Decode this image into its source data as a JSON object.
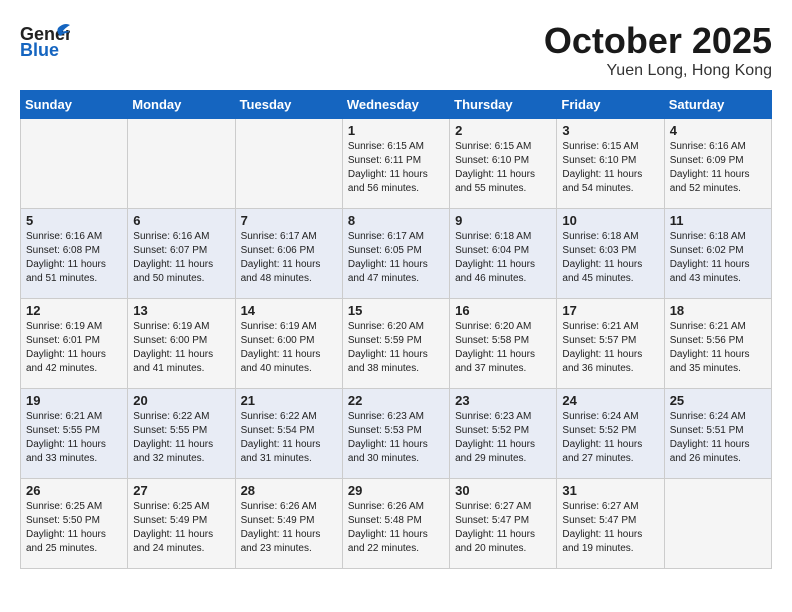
{
  "header": {
    "logo_general": "General",
    "logo_blue": "Blue",
    "month": "October 2025",
    "location": "Yuen Long, Hong Kong"
  },
  "days_of_week": [
    "Sunday",
    "Monday",
    "Tuesday",
    "Wednesday",
    "Thursday",
    "Friday",
    "Saturday"
  ],
  "weeks": [
    [
      {
        "day": "",
        "info": ""
      },
      {
        "day": "",
        "info": ""
      },
      {
        "day": "",
        "info": ""
      },
      {
        "day": "1",
        "info": "Sunrise: 6:15 AM\nSunset: 6:11 PM\nDaylight: 11 hours and 56 minutes."
      },
      {
        "day": "2",
        "info": "Sunrise: 6:15 AM\nSunset: 6:10 PM\nDaylight: 11 hours and 55 minutes."
      },
      {
        "day": "3",
        "info": "Sunrise: 6:15 AM\nSunset: 6:10 PM\nDaylight: 11 hours and 54 minutes."
      },
      {
        "day": "4",
        "info": "Sunrise: 6:16 AM\nSunset: 6:09 PM\nDaylight: 11 hours and 52 minutes."
      }
    ],
    [
      {
        "day": "5",
        "info": "Sunrise: 6:16 AM\nSunset: 6:08 PM\nDaylight: 11 hours and 51 minutes."
      },
      {
        "day": "6",
        "info": "Sunrise: 6:16 AM\nSunset: 6:07 PM\nDaylight: 11 hours and 50 minutes."
      },
      {
        "day": "7",
        "info": "Sunrise: 6:17 AM\nSunset: 6:06 PM\nDaylight: 11 hours and 48 minutes."
      },
      {
        "day": "8",
        "info": "Sunrise: 6:17 AM\nSunset: 6:05 PM\nDaylight: 11 hours and 47 minutes."
      },
      {
        "day": "9",
        "info": "Sunrise: 6:18 AM\nSunset: 6:04 PM\nDaylight: 11 hours and 46 minutes."
      },
      {
        "day": "10",
        "info": "Sunrise: 6:18 AM\nSunset: 6:03 PM\nDaylight: 11 hours and 45 minutes."
      },
      {
        "day": "11",
        "info": "Sunrise: 6:18 AM\nSunset: 6:02 PM\nDaylight: 11 hours and 43 minutes."
      }
    ],
    [
      {
        "day": "12",
        "info": "Sunrise: 6:19 AM\nSunset: 6:01 PM\nDaylight: 11 hours and 42 minutes."
      },
      {
        "day": "13",
        "info": "Sunrise: 6:19 AM\nSunset: 6:00 PM\nDaylight: 11 hours and 41 minutes."
      },
      {
        "day": "14",
        "info": "Sunrise: 6:19 AM\nSunset: 6:00 PM\nDaylight: 11 hours and 40 minutes."
      },
      {
        "day": "15",
        "info": "Sunrise: 6:20 AM\nSunset: 5:59 PM\nDaylight: 11 hours and 38 minutes."
      },
      {
        "day": "16",
        "info": "Sunrise: 6:20 AM\nSunset: 5:58 PM\nDaylight: 11 hours and 37 minutes."
      },
      {
        "day": "17",
        "info": "Sunrise: 6:21 AM\nSunset: 5:57 PM\nDaylight: 11 hours and 36 minutes."
      },
      {
        "day": "18",
        "info": "Sunrise: 6:21 AM\nSunset: 5:56 PM\nDaylight: 11 hours and 35 minutes."
      }
    ],
    [
      {
        "day": "19",
        "info": "Sunrise: 6:21 AM\nSunset: 5:55 PM\nDaylight: 11 hours and 33 minutes."
      },
      {
        "day": "20",
        "info": "Sunrise: 6:22 AM\nSunset: 5:55 PM\nDaylight: 11 hours and 32 minutes."
      },
      {
        "day": "21",
        "info": "Sunrise: 6:22 AM\nSunset: 5:54 PM\nDaylight: 11 hours and 31 minutes."
      },
      {
        "day": "22",
        "info": "Sunrise: 6:23 AM\nSunset: 5:53 PM\nDaylight: 11 hours and 30 minutes."
      },
      {
        "day": "23",
        "info": "Sunrise: 6:23 AM\nSunset: 5:52 PM\nDaylight: 11 hours and 29 minutes."
      },
      {
        "day": "24",
        "info": "Sunrise: 6:24 AM\nSunset: 5:52 PM\nDaylight: 11 hours and 27 minutes."
      },
      {
        "day": "25",
        "info": "Sunrise: 6:24 AM\nSunset: 5:51 PM\nDaylight: 11 hours and 26 minutes."
      }
    ],
    [
      {
        "day": "26",
        "info": "Sunrise: 6:25 AM\nSunset: 5:50 PM\nDaylight: 11 hours and 25 minutes."
      },
      {
        "day": "27",
        "info": "Sunrise: 6:25 AM\nSunset: 5:49 PM\nDaylight: 11 hours and 24 minutes."
      },
      {
        "day": "28",
        "info": "Sunrise: 6:26 AM\nSunset: 5:49 PM\nDaylight: 11 hours and 23 minutes."
      },
      {
        "day": "29",
        "info": "Sunrise: 6:26 AM\nSunset: 5:48 PM\nDaylight: 11 hours and 22 minutes."
      },
      {
        "day": "30",
        "info": "Sunrise: 6:27 AM\nSunset: 5:47 PM\nDaylight: 11 hours and 20 minutes."
      },
      {
        "day": "31",
        "info": "Sunrise: 6:27 AM\nSunset: 5:47 PM\nDaylight: 11 hours and 19 minutes."
      },
      {
        "day": "",
        "info": ""
      }
    ]
  ]
}
